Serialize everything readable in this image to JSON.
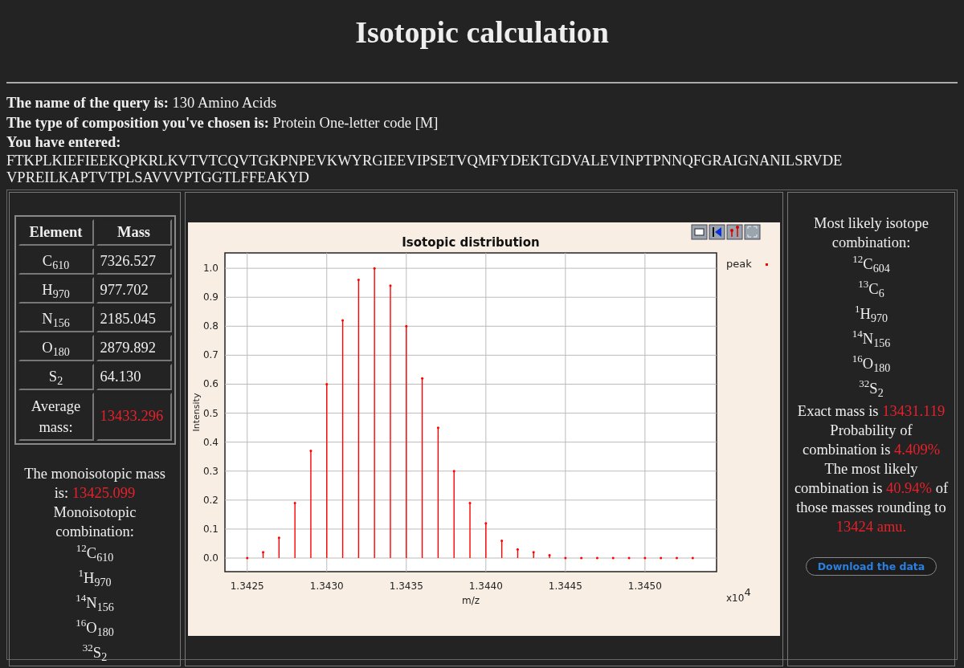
{
  "title": "Isotopic calculation",
  "query_info": [
    {
      "label": "The name of the query is:",
      "value": "130 Amino Acids"
    },
    {
      "label": "The type of composition you've chosen is:",
      "value": "Protein One-letter code [M]"
    },
    {
      "label": "You have entered:"
    }
  ],
  "sequence_lines": [
    "FTKPLKIEFIEEKQPKRLKVTVTCQVTGKPNPEVKWYRGIEEVIPSETVQMFYDEKTGDVALEVINPTPNNQFGRAIGNANILSRVDE",
    "VPREILKAPTVTPLSAVVVPTGGTLFFEAKYD"
  ],
  "composition_table": {
    "columns": [
      "Element",
      "Mass"
    ],
    "rows": [
      {
        "element": "C$_{610}$",
        "mass": "7326.527"
      },
      {
        "element": "H$_{970}$",
        "mass": "977.702"
      },
      {
        "element": "N$_{156}$",
        "mass": "2185.045"
      },
      {
        "element": "O$_{180}$",
        "mass": "2879.892"
      },
      {
        "element": "S$_{2}$",
        "mass": "64.130"
      }
    ],
    "average": {
      "label": "Average mass:",
      "value": "13433.296"
    }
  },
  "monoisotopic": {
    "mass_text": [
      {
        "text": "The monoisotopic mass is: ",
        "highlight": false
      },
      {
        "text": "13425.099",
        "highlight": true
      }
    ],
    "combination_label": "Monoisotopic combination:",
    "isotopes": [
      "$^{12}$C$_{610}$",
      "$^{1}$H$_{970}$",
      "$^{14}$N$_{156}$",
      "$^{16}$O$_{180}$",
      "$^{32}$S$_{2}$"
    ]
  },
  "chart_panel": {
    "axis_multiplier": "x10$^{4}$",
    "chart_data": {
      "type": "bar",
      "title": "Isotopic distribution",
      "xlabel": "m/z",
      "ylabel": "Intensity",
      "x": [
        1.3425,
        1.3426,
        1.3427,
        1.3428,
        1.3429,
        1.343,
        1.3431,
        1.3432,
        1.3433,
        1.3434,
        1.3435,
        1.3436,
        1.3437,
        1.3438,
        1.3439,
        1.344,
        1.3441,
        1.3442,
        1.3443,
        1.3444,
        1.3445,
        1.3446,
        1.3447,
        1.3448,
        1.3449,
        1.345,
        1.3451,
        1.3452,
        1.3453
      ],
      "series": [
        {
          "name": "peak",
          "color": "#ff0000",
          "values": [
            0.0,
            0.02,
            0.07,
            0.19,
            0.37,
            0.6,
            0.82,
            0.96,
            1.0,
            0.94,
            0.8,
            0.62,
            0.45,
            0.3,
            0.19,
            0.12,
            0.06,
            0.03,
            0.02,
            0.01,
            0.0,
            0.0,
            0.0,
            0.0,
            0.0,
            0.0,
            0.0,
            0.0,
            0.0
          ]
        }
      ],
      "grid": true,
      "xlim": [
        1.34236,
        1.34545
      ],
      "ylim": [
        -0.047,
        1.053
      ],
      "xticks": [
        {
          "value": 1.3425,
          "label": "1.3425"
        },
        {
          "value": 1.343,
          "label": "1.3430"
        },
        {
          "value": 1.3435,
          "label": "1.3435"
        },
        {
          "value": 1.344,
          "label": "1.3440"
        },
        {
          "value": 1.3445,
          "label": "1.3445"
        },
        {
          "value": 1.345,
          "label": "1.3450"
        }
      ],
      "yticks": [
        {
          "value": 0,
          "label": "0.0"
        },
        {
          "value": 0.1,
          "label": "0.1"
        },
        {
          "value": 0.2,
          "label": "0.2"
        },
        {
          "value": 0.3,
          "label": "0.3"
        },
        {
          "value": 0.4,
          "label": "0.4"
        },
        {
          "value": 0.5,
          "label": "0.5"
        },
        {
          "value": 0.6,
          "label": "0.6"
        },
        {
          "value": 0.7,
          "label": "0.7"
        },
        {
          "value": 0.8,
          "label": "0.8"
        },
        {
          "value": 0.9,
          "label": "0.9"
        },
        {
          "value": 1.0,
          "label": "1.0"
        }
      ]
    }
  },
  "most_likely": {
    "heading": "Most likely isotope combination:",
    "isotopes": [
      "$^{12}$C$_{604}$",
      "$^{13}$C$_{6}$",
      "$^{1}$H$_{970}$",
      "$^{14}$N$_{156}$",
      "$^{16}$O$_{180}$",
      "$^{32}$S$_{2}$"
    ],
    "paragraphs": [
      [
        {
          "text": "Exact mass is ",
          "highlight": false
        },
        {
          "text": "13431.119",
          "highlight": true
        }
      ],
      [
        {
          "text": "Probability of combination is ",
          "highlight": false
        },
        {
          "text": "4.409%",
          "highlight": true
        }
      ],
      [
        {
          "text": "The most likely combination is ",
          "highlight": false
        },
        {
          "text": "40.94%",
          "highlight": true
        },
        {
          "text": " of those masses rounding to ",
          "highlight": false
        },
        {
          "text": "13424 amu.",
          "highlight": true
        }
      ]
    ]
  },
  "download_button": "Download the data"
}
